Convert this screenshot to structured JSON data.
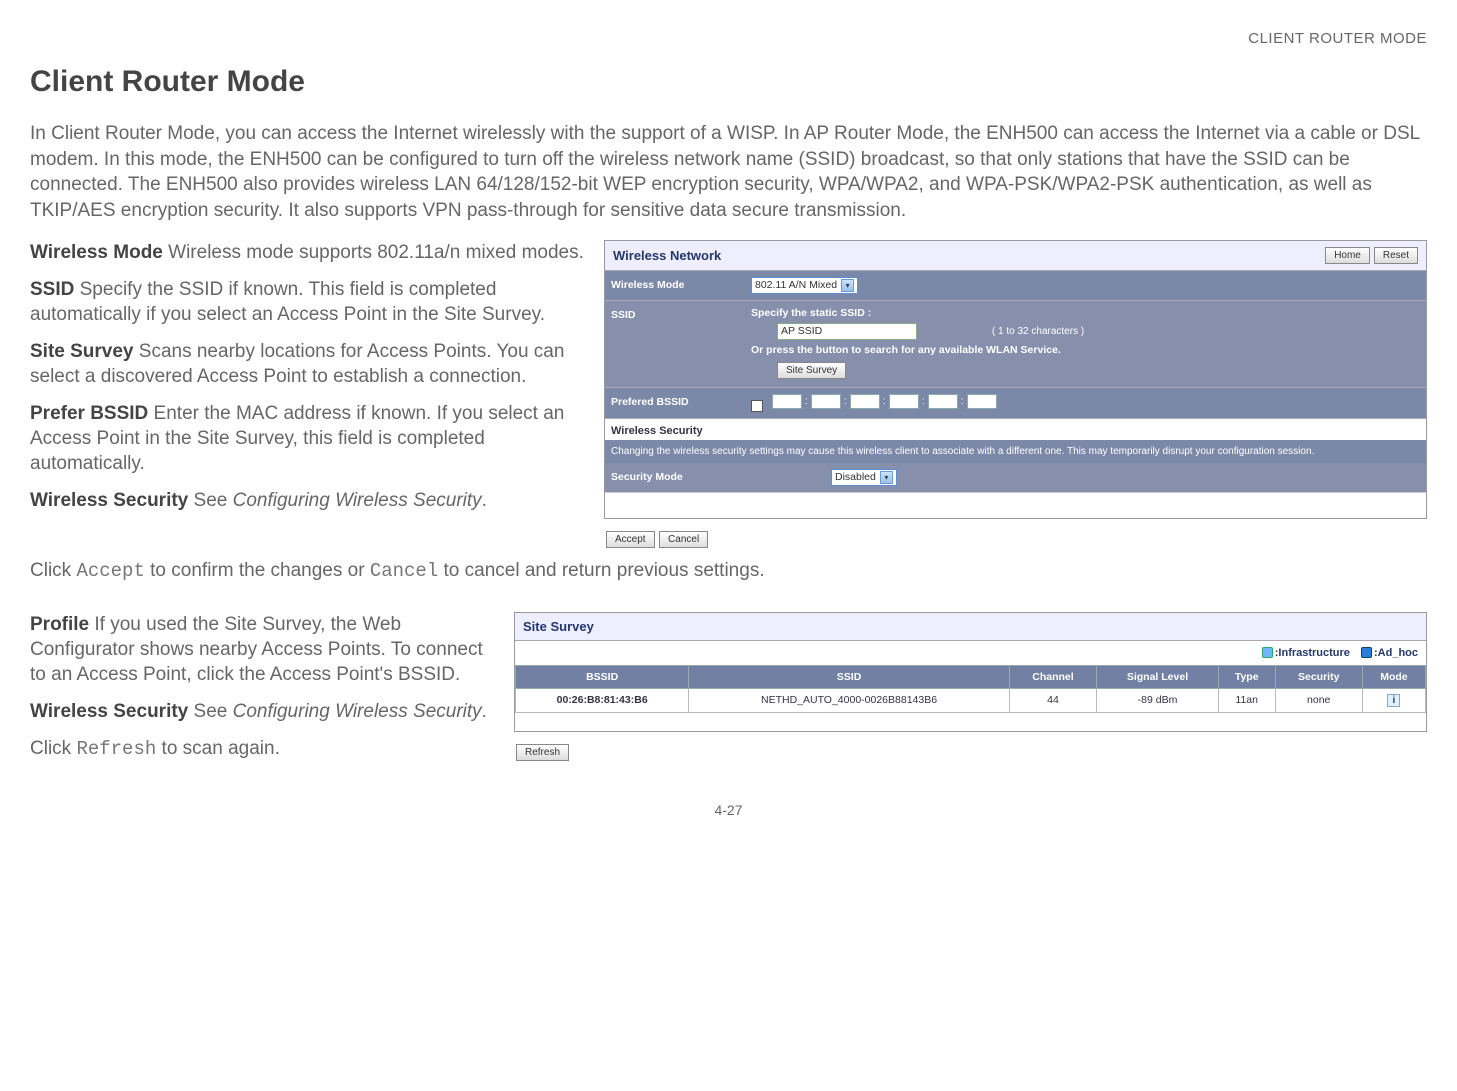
{
  "header": {
    "running": "CLIENT ROUTER MODE"
  },
  "title": "Client Router Mode",
  "intro": "In Client Router Mode, you can access the Internet wirelessly with the support of a WISP. In AP Router Mode, the ENH500 can access the Internet via a cable or DSL modem. In this mode, the ENH500 can be configured to turn off the wireless network name (SSID) broadcast, so that only stations that have the SSID can be connected. The ENH500 also provides wireless LAN 64/128/152-bit WEP encryption security, WPA/WPA2, and WPA-PSK/WPA2-PSK authentication, as well as TKIP/AES encryption security. It also supports VPN pass-through for sensitive data secure transmission.",
  "defs1": {
    "wm_label": "Wireless Mode",
    "wm_text": "  Wireless mode supports 802.11a/n mixed modes.",
    "ssid_label": "SSID",
    "ssid_text": "  Specify the SSID if known. This field is completed automatically if you select an Access Point in the Site Survey.",
    "ss_label": "Site Survey",
    "ss_text": "  Scans nearby locations for Access Points. You can select a discovered Access Point to establish a connection.",
    "pb_label": "Prefer BSSID",
    "pb_text": "  Enter the MAC address if known. If you select an Access Point in the Site Survey, this field is completed automatically.",
    "ws_label": "Wireless Security",
    "ws_pre": "  See ",
    "ws_ital": "Configuring Wireless Security",
    "ws_post": "."
  },
  "accept_line": {
    "pre": "Click ",
    "accept": "Accept",
    "mid": " to confirm the changes or ",
    "cancel": "Cancel",
    "post": " to cancel and return previous settings."
  },
  "panel1": {
    "title": "Wireless Network",
    "home": "Home",
    "reset": "Reset",
    "wm_label": "Wireless Mode",
    "wm_value": "802.11 A/N Mixed",
    "ssid_row_label": "SSID",
    "ssid_line1": "Specify the static SSID  :",
    "ssid_input": "AP SSID",
    "ssid_hint": "( 1 to 32 characters )",
    "ssid_line2": "Or press the button to search for any available WLAN Service.",
    "site_survey_btn": "Site Survey",
    "pb_label": "Prefered BSSID",
    "sec_subhead": "Wireless Security",
    "sec_note": "Changing the wireless security settings may cause this wireless client to associate with a different one. This may temporarily disrupt your configuration session.",
    "secmode_label": "Security Mode",
    "secmode_value": "Disabled",
    "accept_btn": "Accept",
    "cancel_btn": "Cancel"
  },
  "defs2": {
    "profile_label": "Profile",
    "profile_text": "  If you used the Site Survey, the Web Configurator shows nearby Access Points. To connect to an Access Point, click the Access Point's BSSID.",
    "ws_label": "Wireless Security",
    "ws_pre": "  See ",
    "ws_ital": "Configuring Wireless Security",
    "ws_post": "."
  },
  "refresh_line": {
    "pre": "Click ",
    "refresh": "Refresh",
    "post": " to scan again."
  },
  "panel2": {
    "title": "Site Survey",
    "legend_infra": ":Infrastructure",
    "legend_adhoc": ":Ad_hoc",
    "cols": [
      "BSSID",
      "SSID",
      "Channel",
      "Signal Level",
      "Type",
      "Security",
      "Mode"
    ],
    "row": {
      "bssid": "00:26:B8:81:43:B6",
      "ssid": "NETHD_AUTO_4000-0026B88143B6",
      "channel": "44",
      "signal": "-89 dBm",
      "type": "11an",
      "security": "none",
      "mode_icon": "i"
    },
    "refresh_btn": "Refresh"
  },
  "pagenum": "4-27"
}
